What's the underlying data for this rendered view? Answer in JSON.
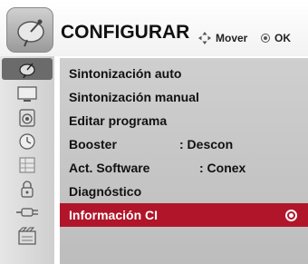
{
  "header": {
    "title": "CONFIGURAR",
    "hint_move": "Mover",
    "hint_ok": "OK",
    "icon": "satellite-dish-icon"
  },
  "sidebar": {
    "items": [
      {
        "icon": "satellite-dish-icon",
        "active": true
      },
      {
        "icon": "tv-screen-icon",
        "active": false
      },
      {
        "icon": "speaker-icon",
        "active": false
      },
      {
        "icon": "clock-icon",
        "active": false
      },
      {
        "icon": "grid-options-icon",
        "active": false
      },
      {
        "icon": "lock-icon",
        "active": false
      },
      {
        "icon": "input-plug-icon",
        "active": false
      },
      {
        "icon": "media-card-icon",
        "active": false
      }
    ]
  },
  "menu": {
    "items": [
      {
        "label": "Sintonización auto",
        "value": ""
      },
      {
        "label": "Sintonización manual",
        "value": ""
      },
      {
        "label": "Editar programa",
        "value": ""
      },
      {
        "label": "Booster",
        "value": ": Descon"
      },
      {
        "label": "Act. Software",
        "value": ": Conex"
      },
      {
        "label": "Diagnóstico",
        "value": ""
      },
      {
        "label": "Información CI",
        "value": "",
        "selected": true
      }
    ]
  },
  "colors": {
    "selected_row": "#b0152a",
    "panel": "#c6c6c6",
    "sidebar_active": "#6b6b6b"
  }
}
